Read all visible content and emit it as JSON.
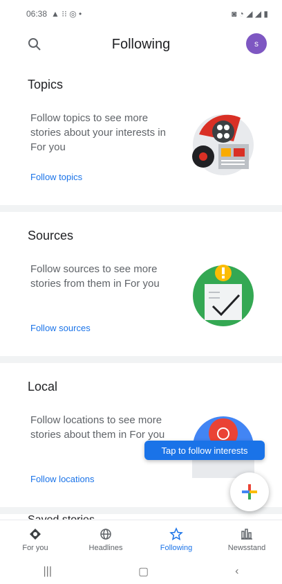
{
  "status_bar": {
    "time": "06:38",
    "icons_left": "▲ ⁝⁝ ◎ •",
    "icons_right": "◙ ◔ ◢ ◢ ▮"
  },
  "app_bar": {
    "title": "Following",
    "avatar_letter": "s"
  },
  "cards": [
    {
      "title": "Topics",
      "description": "Follow topics to see more stories about your interests in For you",
      "link": "Follow topics"
    },
    {
      "title": "Sources",
      "description": "Follow sources to see more stories from them in For you",
      "link": "Follow sources"
    },
    {
      "title": "Local",
      "description": "Follow locations to see more stories about them in For you",
      "link": "Follow locations"
    }
  ],
  "partial_section_title": "Saved stories",
  "tooltip": "Tap to follow interests",
  "bottom_nav": [
    {
      "label": "For you",
      "icon": "diamond-icon"
    },
    {
      "label": "Headlines",
      "icon": "globe-icon"
    },
    {
      "label": "Following",
      "icon": "star-icon",
      "active": true
    },
    {
      "label": "Newsstand",
      "icon": "newsstand-icon"
    }
  ],
  "system_nav": {
    "recents": "|||",
    "home": "▢",
    "back": "‹"
  },
  "colors": {
    "accent": "#1a73e8",
    "avatar": "#7e57c2"
  }
}
